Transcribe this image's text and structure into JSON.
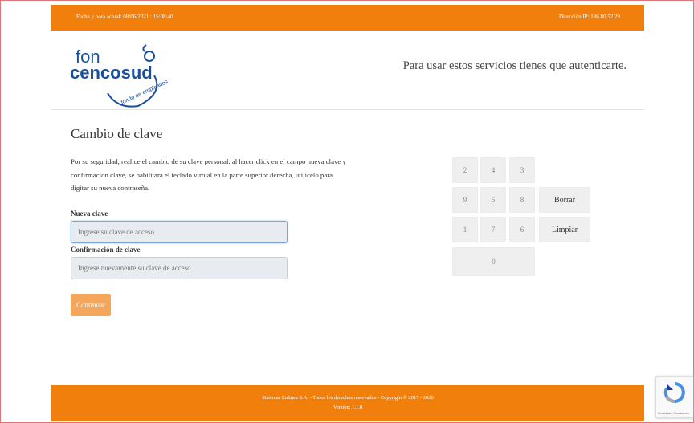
{
  "topbar": {
    "datetime": "Fecha y hora actual: 08/06/2021 : 15:08:40",
    "ip": "Dirección IP: 186.80.52.29"
  },
  "header": {
    "logo_text": "fon cencosud fondo de empleados",
    "message": "Para usar estos servicios tienes que autenticarte."
  },
  "form": {
    "title": "Cambio de clave",
    "description": "Por su seguridad, realice el cambio de su clave personal. al hacer click en el campo nueva clave y confirmacion clave, se habilitara el teclado virtual en la parte superior derecha, utilicelo para digitar su nueva contraseña.",
    "new_label": "Nueva clave",
    "new_placeholder": "Ingrese su clave de acceso",
    "confirm_label": "Confirmación de clave",
    "confirm_placeholder": "Ingrese nuevamente su clave de acceso",
    "submit_label": "Continuar"
  },
  "keypad": {
    "row1": [
      "2",
      "4",
      "3"
    ],
    "row2": [
      "9",
      "5",
      "8"
    ],
    "row3": [
      "1",
      "7",
      "6"
    ],
    "zero": "0",
    "delete_label": "Borrar",
    "clear_label": "Limpiar"
  },
  "footer": {
    "line1": "Sistemas Enlinea S.A. - Todos los derechos reservados - Copyright © 2017 - 2020",
    "line2": "Version: 1.1.0"
  },
  "recaptcha": {
    "text": "Privacidad - Condiciones"
  },
  "colors": {
    "brand_orange": "#f07f0c",
    "logo_blue": "#1a4f9c"
  }
}
